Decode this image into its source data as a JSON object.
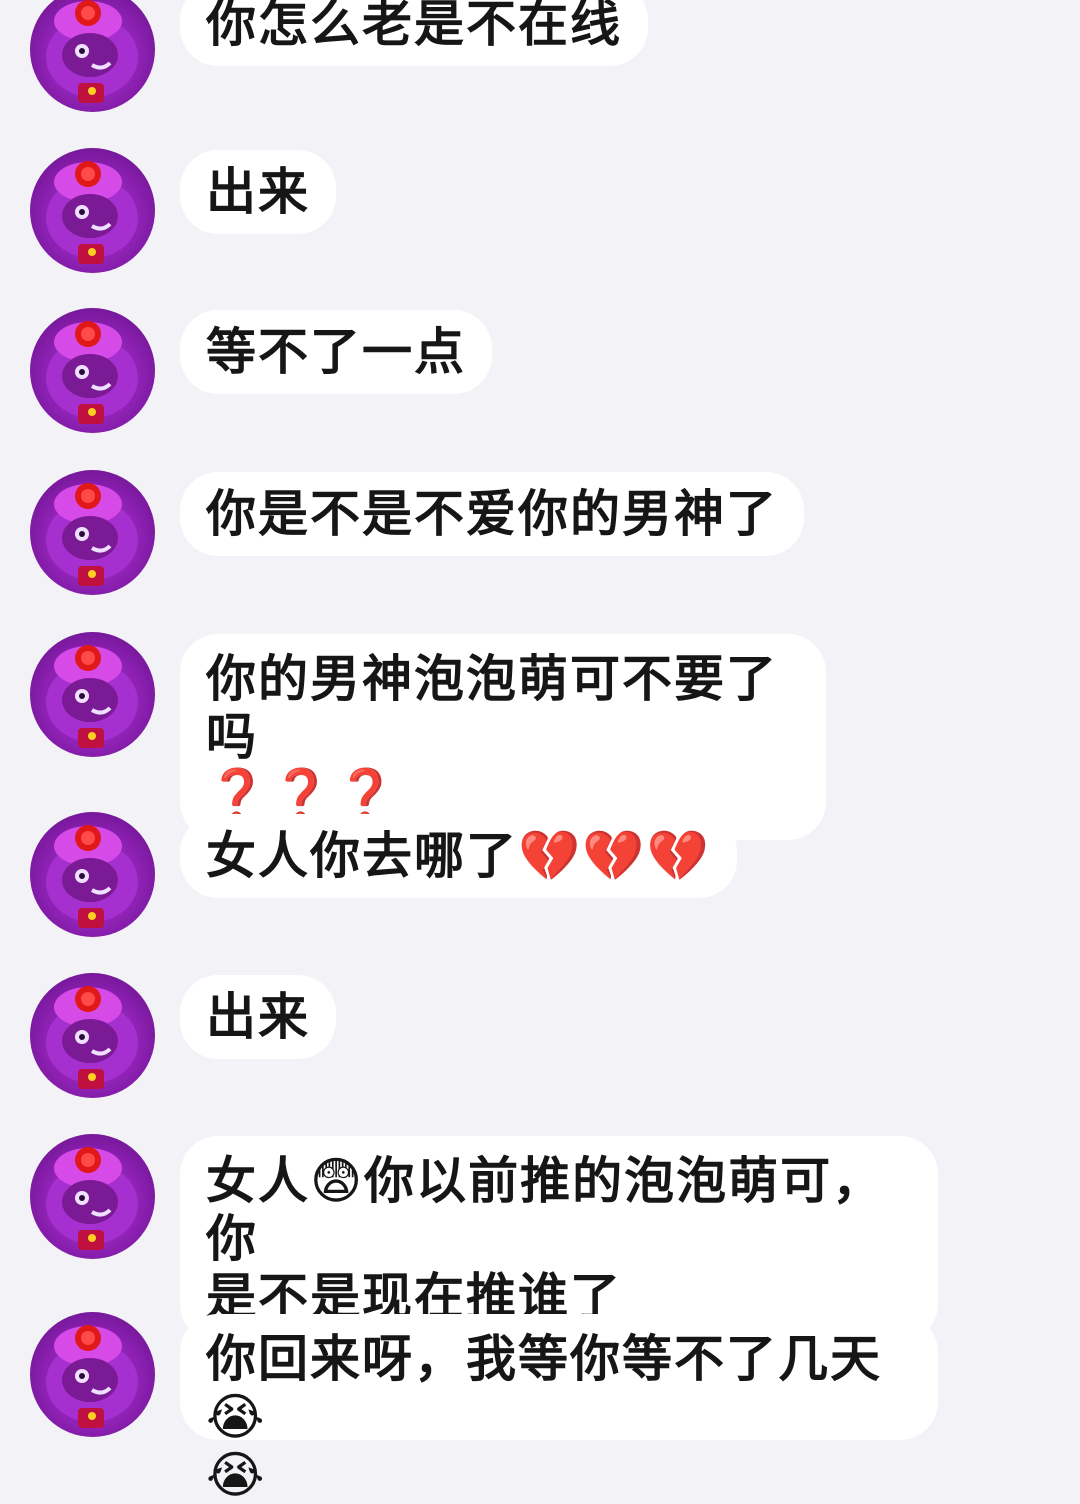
{
  "messages": [
    {
      "text": "你怎么老是不在线"
    },
    {
      "text": "出来"
    },
    {
      "text": "等不了一点"
    },
    {
      "text": "你是不是不爱你的男神了"
    },
    {
      "text": "你的男神泡泡萌可不要了吗\n❓❓❓"
    },
    {
      "text": "女人你去哪了💔💔💔"
    },
    {
      "text": "出来"
    },
    {
      "text": "女人😨你以前推的泡泡萌可，你\n是不是现在推谁了"
    },
    {
      "text": "你回来呀，我等你等不了几天😭\n😭"
    }
  ]
}
